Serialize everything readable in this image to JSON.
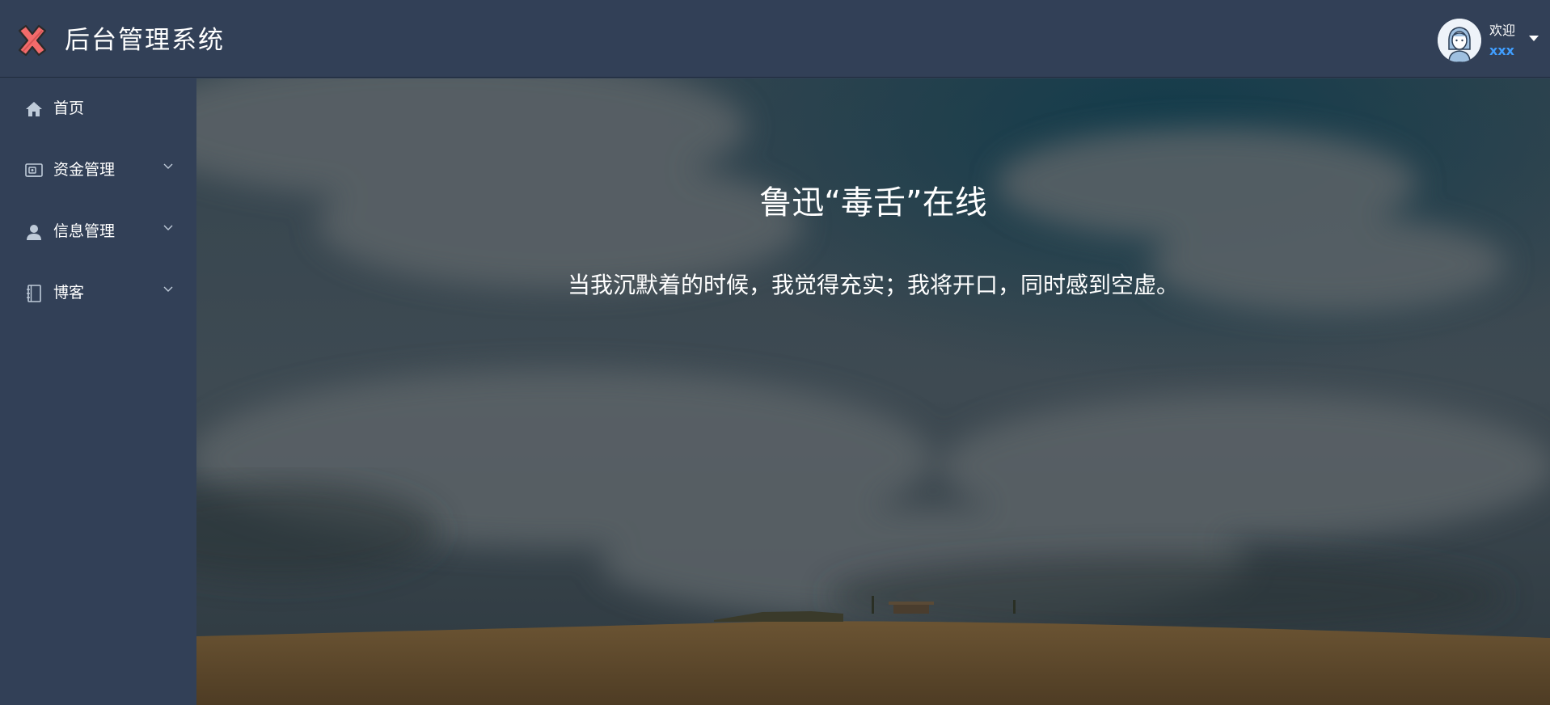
{
  "app": {
    "title": "后台管理系统",
    "logo_icon": "close-x-logo-icon"
  },
  "user": {
    "welcome": "欢迎",
    "name": "xxx",
    "avatar_icon": "user-avatar-icon"
  },
  "sidebar": {
    "items": [
      {
        "label": "首页",
        "icon": "home-icon",
        "expandable": false
      },
      {
        "label": "资金管理",
        "icon": "wallet-icon",
        "expandable": true
      },
      {
        "label": "信息管理",
        "icon": "user-icon",
        "expandable": true
      },
      {
        "label": "博客",
        "icon": "notebook-icon",
        "expandable": true
      }
    ]
  },
  "main": {
    "title": "鲁迅“毒舌”在线",
    "quote": "当我沉默着的时候，我觉得充实；我将开口，同时感到空虚。"
  },
  "colors": {
    "header_bg": "#324057",
    "sidebar_bg": "#324057",
    "accent": "#409eff",
    "text": "#ffffff"
  }
}
